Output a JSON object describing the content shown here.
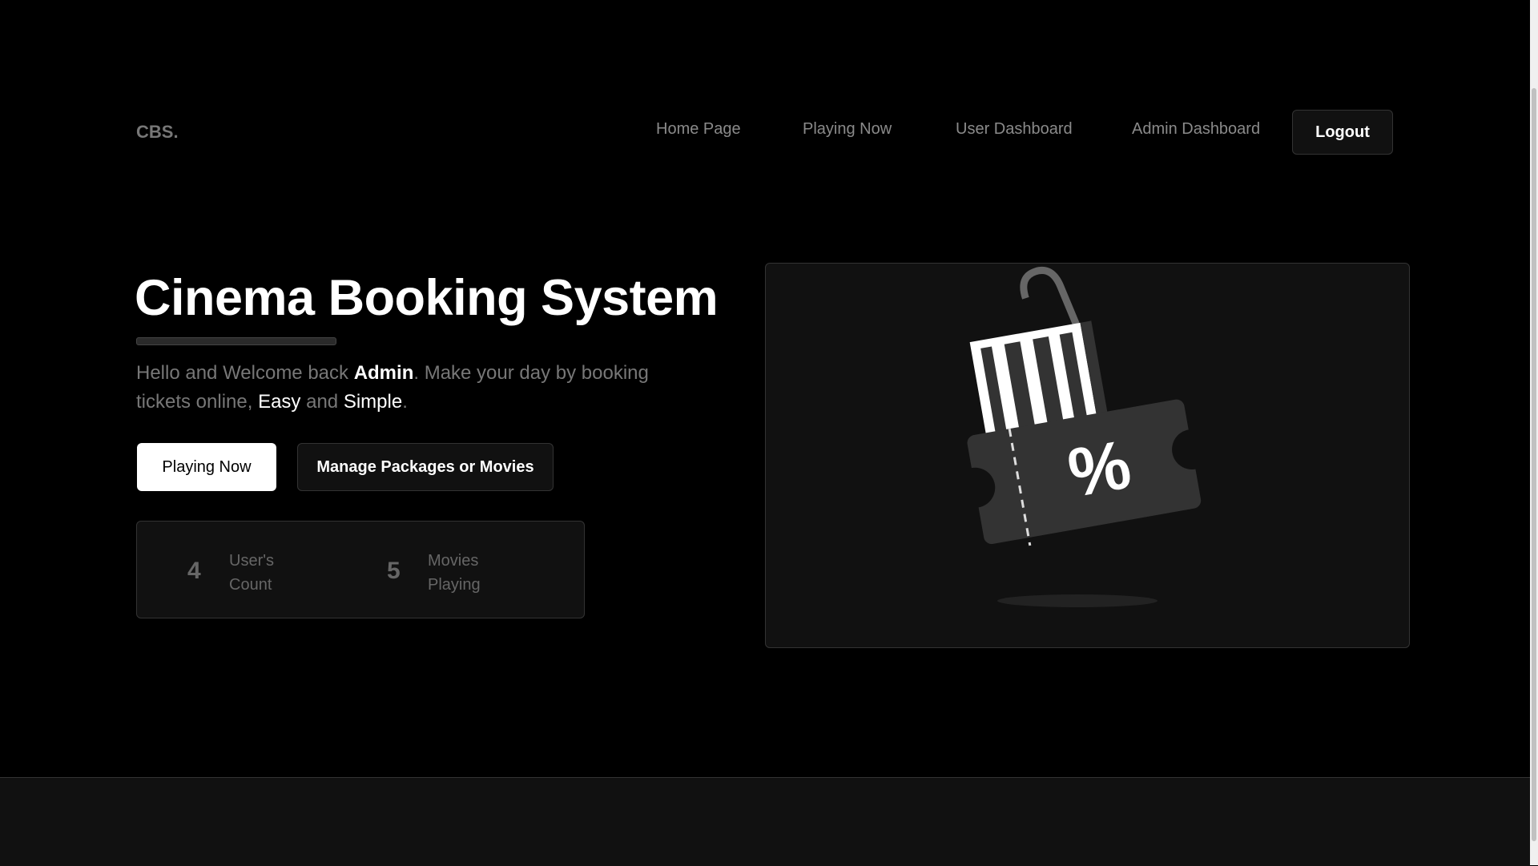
{
  "nav": {
    "logo": "CBS.",
    "items": [
      {
        "label": "Home Page"
      },
      {
        "label": "Playing Now"
      },
      {
        "label": "User Dashboard"
      },
      {
        "label": "Admin Dashboard"
      }
    ],
    "logout_label": "Logout"
  },
  "hero": {
    "title": "Cinema Booking System",
    "intro": {
      "part1": "Hello and Welcome back ",
      "user": "Admin",
      "part2": ". Make your day by booking tickets online, ",
      "easy": "Easy",
      "and": " and ",
      "simple": "Simple",
      "end": "."
    },
    "buttons": {
      "playing_now": "Playing Now",
      "manage": "Manage Packages or Movies"
    },
    "stats": [
      {
        "value": "4",
        "label1": "User's",
        "label2": "Count"
      },
      {
        "value": "5",
        "label1": "Movies",
        "label2": "Playing"
      }
    ],
    "illustration": {
      "icon": "discount-ticket-shopping-bag-icon",
      "symbol": "%"
    }
  },
  "colors": {
    "background": "#000000",
    "panel": "#111111",
    "border": "#333333",
    "muted_text": "#777777"
  }
}
